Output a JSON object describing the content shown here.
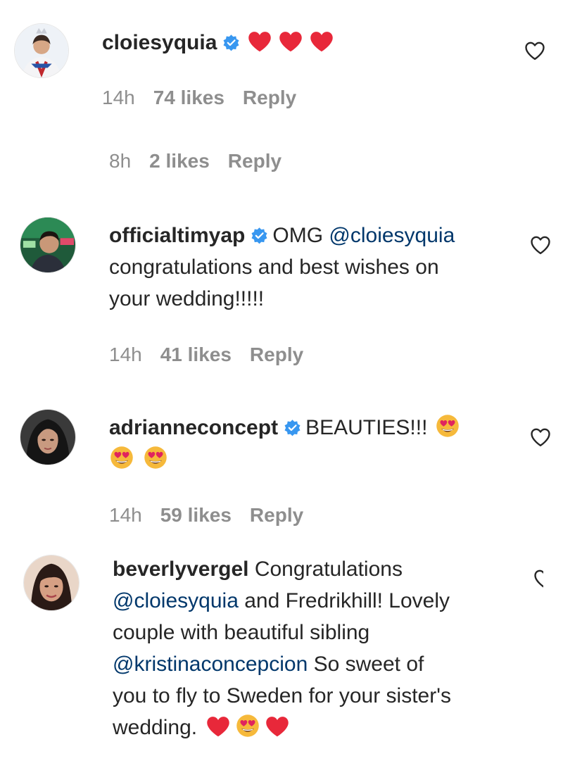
{
  "comments": [
    {
      "username": "cloiesyquia",
      "verified": true,
      "text": "",
      "time": "14h",
      "likes": "74 likes",
      "reply": "Reply"
    },
    {
      "time": "8h",
      "likes": "2 likes",
      "reply": "Reply"
    },
    {
      "username": "officialtimyap",
      "verified": true,
      "text_parts": [
        "OMG",
        "@cloiesyquia",
        "congratulations and best wishes on",
        "your wedding!!!!!"
      ],
      "time": "14h",
      "likes": "41 likes",
      "reply": "Reply"
    },
    {
      "username": "adrianneconcept",
      "verified": true,
      "text": "BEAUTIES!!!",
      "time": "14h",
      "likes": "59 likes",
      "reply": "Reply"
    },
    {
      "username": "beverlyvergel",
      "verified": false,
      "text_parts": [
        "Congratulations",
        "@cloiesyquia",
        "and Fredrikhill! Lovely",
        "couple with beautiful sibling",
        "@kristinaconcepcion",
        "So sweet of",
        "you to fly to Sweden for your sister's",
        "wedding."
      ]
    }
  ],
  "icons": {
    "verified": "verified-badge-icon",
    "like": "heart-outline-icon",
    "red_heart": "red-heart-emoji",
    "heart_eyes": "heart-eyes-emoji"
  },
  "colors": {
    "mention": "#00376b",
    "verified": "#3897f0",
    "meta": "#8e8e8e",
    "red_heart": "#e8283a"
  }
}
